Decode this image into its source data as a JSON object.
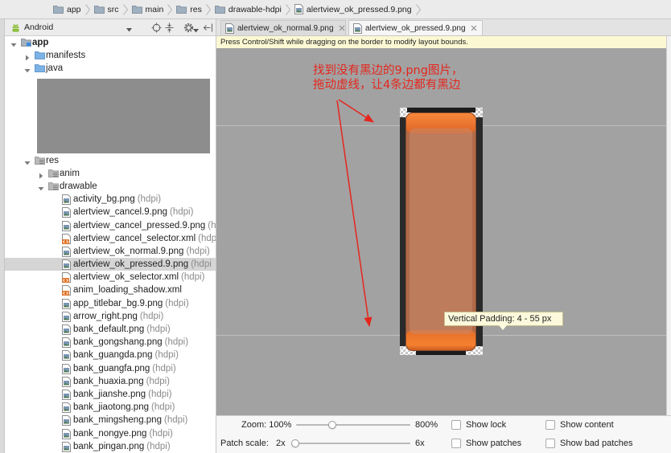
{
  "breadcrumb": [
    {
      "label": "app",
      "icon": "folder-icon"
    },
    {
      "label": "src",
      "icon": "folder-icon"
    },
    {
      "label": "main",
      "icon": "folder-icon"
    },
    {
      "label": "res",
      "icon": "folder-icon"
    },
    {
      "label": "drawable-hdpi",
      "icon": "folder-icon"
    },
    {
      "label": "alertview_ok_pressed.9.png",
      "icon": "image-file-icon"
    }
  ],
  "project_view": {
    "label": "Android",
    "icon": "android-icon"
  },
  "tabs": [
    {
      "label": "alertview_ok_normal.9.png",
      "active": false,
      "icon": "image-file-icon"
    },
    {
      "label": "alertview_ok_pressed.9.png",
      "active": true,
      "icon": "image-file-icon"
    }
  ],
  "tree": {
    "top": [
      {
        "label": "app",
        "depth": 0,
        "arrow": "expanded",
        "icon": "module-folder-icon"
      },
      {
        "label": "manifests",
        "depth": 1,
        "arrow": "collapsed",
        "icon": "source-folder-icon"
      },
      {
        "label": "java",
        "depth": 1,
        "arrow": "expanded",
        "icon": "source-folder-icon"
      }
    ],
    "bottom": [
      {
        "label": "res",
        "depth": 1,
        "arrow": "expanded",
        "icon": "resource-folder-icon"
      },
      {
        "label": "anim",
        "depth": 2,
        "arrow": "collapsed",
        "icon": "resource-folder-icon"
      },
      {
        "label": "drawable",
        "depth": 2,
        "arrow": "expanded",
        "icon": "resource-folder-icon"
      },
      {
        "label": "activity_bg.png",
        "qualifier": "(hdpi)",
        "depth": 3,
        "icon": "image-file-icon"
      },
      {
        "label": "alertview_cancel.9.png",
        "qualifier": "(hdpi)",
        "depth": 3,
        "icon": "image-file-icon"
      },
      {
        "label": "alertview_cancel_pressed.9.png",
        "qualifier": "(h",
        "depth": 3,
        "icon": "image-file-icon"
      },
      {
        "label": "alertview_cancel_selector.xml",
        "qualifier": "(hdp",
        "depth": 3,
        "icon": "xml-file-icon"
      },
      {
        "label": "alertview_ok_normal.9.png",
        "qualifier": "(hdpi)",
        "depth": 3,
        "icon": "image-file-icon"
      },
      {
        "label": "alertview_ok_pressed.9.png",
        "qualifier": "(hdpi",
        "depth": 3,
        "icon": "image-file-icon",
        "selected": true
      },
      {
        "label": "alertview_ok_selector.xml",
        "qualifier": "(hdpi)",
        "depth": 3,
        "icon": "xml-file-icon"
      },
      {
        "label": "anim_loading_shadow.xml",
        "depth": 3,
        "icon": "xml-file-icon"
      },
      {
        "label": "app_titlebar_bg.9.png",
        "qualifier": "(hdpi)",
        "depth": 3,
        "icon": "image-file-icon"
      },
      {
        "label": "arrow_right.png",
        "qualifier": "(hdpi)",
        "depth": 3,
        "icon": "image-file-icon"
      },
      {
        "label": "bank_default.png",
        "qualifier": "(hdpi)",
        "depth": 3,
        "icon": "image-file-icon"
      },
      {
        "label": "bank_gongshang.png",
        "qualifier": "(hdpi)",
        "depth": 3,
        "icon": "image-file-icon"
      },
      {
        "label": "bank_guangda.png",
        "qualifier": "(hdpi)",
        "depth": 3,
        "icon": "image-file-icon"
      },
      {
        "label": "bank_guangfa.png",
        "qualifier": "(hdpi)",
        "depth": 3,
        "icon": "image-file-icon"
      },
      {
        "label": "bank_huaxia.png",
        "qualifier": "(hdpi)",
        "depth": 3,
        "icon": "image-file-icon"
      },
      {
        "label": "bank_jianshe.png",
        "qualifier": "(hdpi)",
        "depth": 3,
        "icon": "image-file-icon"
      },
      {
        "label": "bank_jiaotong.png",
        "qualifier": "(hdpi)",
        "depth": 3,
        "icon": "image-file-icon"
      },
      {
        "label": "bank_mingsheng.png",
        "qualifier": "(hdpi)",
        "depth": 3,
        "icon": "image-file-icon"
      },
      {
        "label": "bank_nongye.png",
        "qualifier": "(hdpi)",
        "depth": 3,
        "icon": "image-file-icon"
      },
      {
        "label": "bank_pingan.png",
        "qualifier": "(hdpi)",
        "depth": 3,
        "icon": "image-file-icon"
      }
    ]
  },
  "info_bar": {
    "text": "Press Control/Shift while dragging on the border to modify layout bounds."
  },
  "annotation": {
    "line1": "找到没有黑边的9.png图片，",
    "line2": "拖动虚线，让4条边都有黑边",
    "color": "#e5261d"
  },
  "tooltip": {
    "text": "Vertical Padding: 4 - 55 px"
  },
  "controls": {
    "zoom": {
      "label": "Zoom: 100%",
      "max_label": "800%",
      "level": 0.3
    },
    "patch_scale": {
      "label": "Patch scale:",
      "min_label": "2x",
      "max_label": "6x",
      "level": 0
    },
    "checkboxes": {
      "show_lock": {
        "label": "Show lock",
        "checked": false
      },
      "show_content": {
        "label": "Show content",
        "checked": false
      },
      "show_patches": {
        "label": "Show patches",
        "checked": false
      },
      "show_bad_patches": {
        "label": "Show bad patches",
        "checked": false
      }
    }
  }
}
